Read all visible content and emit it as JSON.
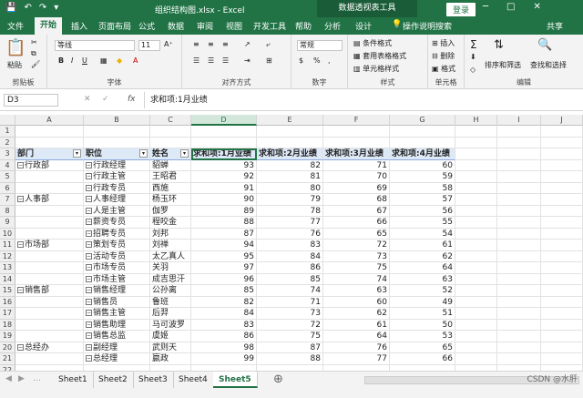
{
  "titlebar": {
    "title": "组织结构图.xlsx - Excel",
    "context_tab": "数据透视表工具",
    "login": "登录",
    "minimize": "─",
    "restore": "□",
    "close": "✕"
  },
  "ribbon_tabs": [
    "文件",
    "开始",
    "插入",
    "页面布局",
    "公式",
    "数据",
    "审阅",
    "视图",
    "开发工具",
    "帮助",
    "分析",
    "设计"
  ],
  "ribbon_search": "操作说明搜索",
  "share": "共享",
  "ribbon": {
    "paste": "粘贴",
    "clipboard": "剪贴板",
    "font_name": "等线",
    "font_size": "11",
    "font_group": "字体",
    "align_group": "对齐方式",
    "number_format": "常规",
    "number_group": "数字",
    "cond_format": "条件格式",
    "table_format": "套用表格格式",
    "cell_style": "单元格样式",
    "styles_group": "样式",
    "insert": "插入",
    "delete": "删除",
    "format": "格式",
    "cells_group": "单元格",
    "sort_filter": "排序和筛选",
    "find_select": "查找和选择",
    "edit_group": "编辑"
  },
  "formula_bar": {
    "name_box": "D3",
    "formula": "求和项:1月业绩"
  },
  "columns": [
    "A",
    "B",
    "C",
    "D",
    "E",
    "F",
    "G",
    "H",
    "I",
    "J"
  ],
  "pivot_headers": [
    "部门",
    "职位",
    "姓名",
    "求和项:1月业绩",
    "求和项:2月业绩",
    "求和项:3月业绩",
    "求和项:4月业绩"
  ],
  "rows": [
    {
      "dept": "行政部",
      "pos": "行政经理",
      "name": "貂蝉",
      "m1": 93,
      "m2": 82,
      "m3": 71,
      "m4": 60
    },
    {
      "dept": "",
      "pos": "行政主管",
      "name": "王昭君",
      "m1": 92,
      "m2": 81,
      "m3": 70,
      "m4": 59
    },
    {
      "dept": "",
      "pos": "行政专员",
      "name": "西施",
      "m1": 91,
      "m2": 80,
      "m3": 69,
      "m4": 58
    },
    {
      "dept": "人事部",
      "pos": "人事经理",
      "name": "杨玉环",
      "m1": 90,
      "m2": 79,
      "m3": 68,
      "m4": 57
    },
    {
      "dept": "",
      "pos": "人是主管",
      "name": "伽罗",
      "m1": 89,
      "m2": 78,
      "m3": 67,
      "m4": 56
    },
    {
      "dept": "",
      "pos": "薪资专员",
      "name": "程咬金",
      "m1": 88,
      "m2": 77,
      "m3": 66,
      "m4": 55
    },
    {
      "dept": "",
      "pos": "招聘专员",
      "name": "刘邦",
      "m1": 87,
      "m2": 76,
      "m3": 65,
      "m4": 54
    },
    {
      "dept": "市场部",
      "pos": "策划专员",
      "name": "刘禅",
      "m1": 94,
      "m2": 83,
      "m3": 72,
      "m4": 61
    },
    {
      "dept": "",
      "pos": "活动专员",
      "name": "太乙真人",
      "m1": 95,
      "m2": 84,
      "m3": 73,
      "m4": 62
    },
    {
      "dept": "",
      "pos": "市场专员",
      "name": "关羽",
      "m1": 97,
      "m2": 86,
      "m3": 75,
      "m4": 64
    },
    {
      "dept": "",
      "pos": "市场主管",
      "name": "成吉思汗",
      "m1": 96,
      "m2": 85,
      "m3": 74,
      "m4": 63
    },
    {
      "dept": "销售部",
      "pos": "销售经理",
      "name": "公孙离",
      "m1": 85,
      "m2": 74,
      "m3": 63,
      "m4": 52
    },
    {
      "dept": "",
      "pos": "销售员",
      "name": "鲁班",
      "m1": 82,
      "m2": 71,
      "m3": 60,
      "m4": 49
    },
    {
      "dept": "",
      "pos": "销售主管",
      "name": "后羿",
      "m1": 84,
      "m2": 73,
      "m3": 62,
      "m4": 51
    },
    {
      "dept": "",
      "pos": "销售助理",
      "name": "马可波罗",
      "m1": 83,
      "m2": 72,
      "m3": 61,
      "m4": 50
    },
    {
      "dept": "",
      "pos": "销售总监",
      "name": "虞姬",
      "m1": 86,
      "m2": 75,
      "m3": 64,
      "m4": 53
    },
    {
      "dept": "总经办",
      "pos": "副经理",
      "name": "武则天",
      "m1": 98,
      "m2": 87,
      "m3": 76,
      "m4": 65
    },
    {
      "dept": "",
      "pos": "总经理",
      "name": "嬴政",
      "m1": 99,
      "m2": 88,
      "m3": 77,
      "m4": 66
    }
  ],
  "sheets": [
    "Sheet1",
    "Sheet2",
    "Sheet3",
    "Sheet4",
    "Sheet5"
  ],
  "active_sheet": "Sheet5",
  "watermark": "CSDN @水肝",
  "colors": {
    "excel_green": "#217346",
    "pivot_header": "#dde9f6"
  }
}
